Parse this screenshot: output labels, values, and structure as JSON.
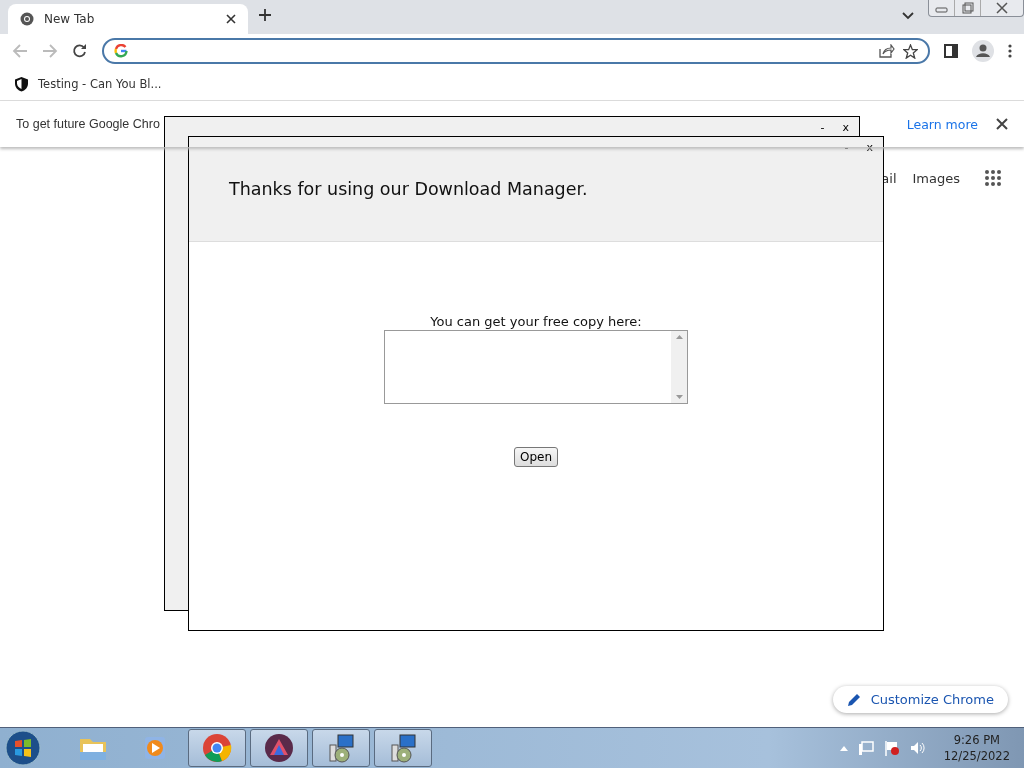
{
  "browser": {
    "tabs": [
      {
        "title": "New Tab",
        "selected": true
      }
    ],
    "bookmarks": [
      {
        "label": "Testing - Can You Bl..."
      }
    ],
    "infobar": {
      "message": "To get future Google Chro",
      "link": "Learn more"
    },
    "header_links": [
      "ail",
      "Images"
    ],
    "customize_button": "Customize Chrome"
  },
  "popups": [
    {
      "minimize": "-",
      "close": "x"
    },
    {
      "minimize": "-",
      "close": "x",
      "title": "Thanks for using our Download Manager.",
      "prompt": "You can get your free copy here:",
      "button": "Open"
    }
  ],
  "taskbar": {
    "apps": [
      {
        "kind": "folder",
        "running": false
      },
      {
        "kind": "media",
        "running": false
      },
      {
        "kind": "chrome",
        "running": true
      },
      {
        "kind": "app",
        "running": true
      },
      {
        "kind": "installer",
        "running": true
      },
      {
        "kind": "installer",
        "running": true
      }
    ],
    "time": "9:26 PM",
    "date": "12/25/2022"
  }
}
